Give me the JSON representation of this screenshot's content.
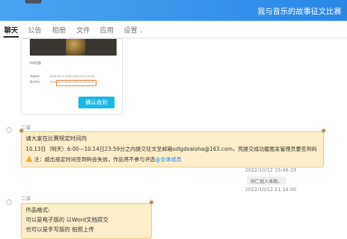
{
  "header": {
    "group_title": "我与音乐的故事征文比赛"
  },
  "tabs": [
    {
      "label": "聊天"
    },
    {
      "label": "公告"
    },
    {
      "label": "相册"
    },
    {
      "label": "文件"
    },
    {
      "label": "应用"
    },
    {
      "label": "设置"
    }
  ],
  "card": {
    "info_heading": "时间范围",
    "row1_label": "开始时间",
    "row1_value": "2022.10.11 09:00-2022.10.13 10:00",
    "row2_label": "提交时间",
    "row2_value": "2022.10.13 06:00-2022.10.14 23:59",
    "confirm_label": "确认收到"
  },
  "message1": {
    "sender": "二课",
    "line1": "请大家在比赛规定时间内",
    "line2": "10.13日（明天）6:00—10.14日23:59分之内提交征文至邮箱sdlgdxaloha@163.com，凭提交成功截图发管理员要签到码",
    "line3_text": "注：超出规定时间签到码会失效，作品将不参与评选",
    "line3_mention": "@全体成员"
  },
  "timestamp1": "2022/10/12 15:46:29",
  "system_notice": "卅匚加入本群。",
  "timestamp2": "2022/10/12 21:14:00",
  "message2": {
    "sender": "二课",
    "line1": "作品格式:",
    "line2": "可以是电子版的 以Word文档提交",
    "line3": "也可以是手写版的 拍照上传"
  },
  "colors": {
    "header_start": "#4aa3f0",
    "header_end": "#2b87e8",
    "confirm_button": "#18b8e6",
    "bubble_bg": "#fbeec8",
    "highlight_border": "#f07a22"
  }
}
